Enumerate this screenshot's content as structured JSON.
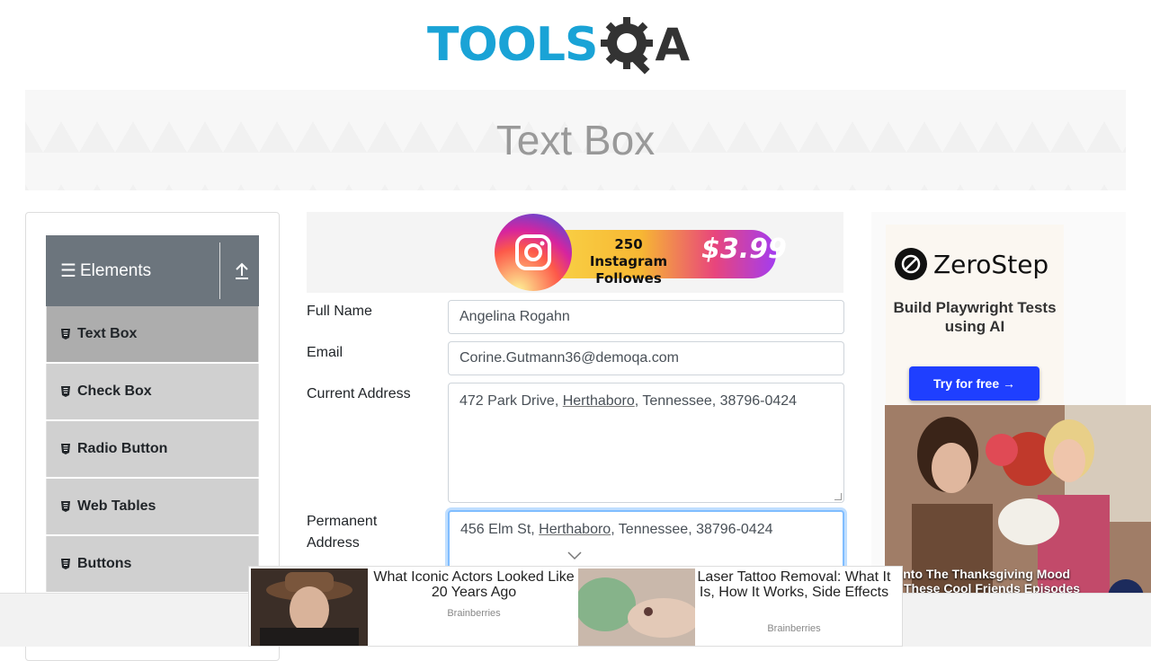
{
  "header": {
    "logo_primary": "TOOLS",
    "logo_secondary": "A"
  },
  "banner": {
    "title": "Text Box"
  },
  "sidebar": {
    "group_title": "Elements",
    "items": [
      {
        "label": "Text Box",
        "active": true
      },
      {
        "label": "Check Box",
        "active": false
      },
      {
        "label": "Radio Button",
        "active": false
      },
      {
        "label": "Web Tables",
        "active": false
      },
      {
        "label": "Buttons",
        "active": false
      }
    ]
  },
  "top_ad": {
    "line1": "250 Instagram",
    "line2": "Followes",
    "price": "$3.99"
  },
  "form": {
    "full_name": {
      "label": "Full Name",
      "value": "Angelina Rogahn"
    },
    "email": {
      "label": "Email",
      "value": "Corine.Gutmann36@demoqa.com"
    },
    "current_address": {
      "label": "Current Address",
      "value_pre": "472 Park Drive, ",
      "value_u": "Herthaboro",
      "value_post": ", Tennessee, 38796-0424"
    },
    "permanent_address": {
      "label": "Permanent Address",
      "value_pre": "456 Elm St, ",
      "value_u": "Herthaboro",
      "value_post": ", Tennessee, 38796-0424"
    }
  },
  "right_ad": {
    "brand": "ZeroStep",
    "tagline": "Build Playwright Tests using AI",
    "cta": "Try for free →"
  },
  "video_ad": {
    "caption_line1": "et Into The Thanksgiving Mood",
    "caption_line2": "ith These Cool Friends Episodes",
    "next": "›"
  },
  "bottom_ad": {
    "item1_title": "What Iconic Actors Looked Like 20 Years Ago",
    "item1_source": "Brainberries",
    "item2_title": "Laser Tattoo Removal: What It Is, How It Works, Side Effects",
    "item2_source": "Brainberries"
  },
  "colors": {
    "logo_blue": "#1aa3d6",
    "group_header": "#6c757d",
    "menu_active": "#adadad",
    "menu_item": "#d0d0d0",
    "cta_blue": "#1f3fff",
    "focus_border": "#80bdff"
  }
}
